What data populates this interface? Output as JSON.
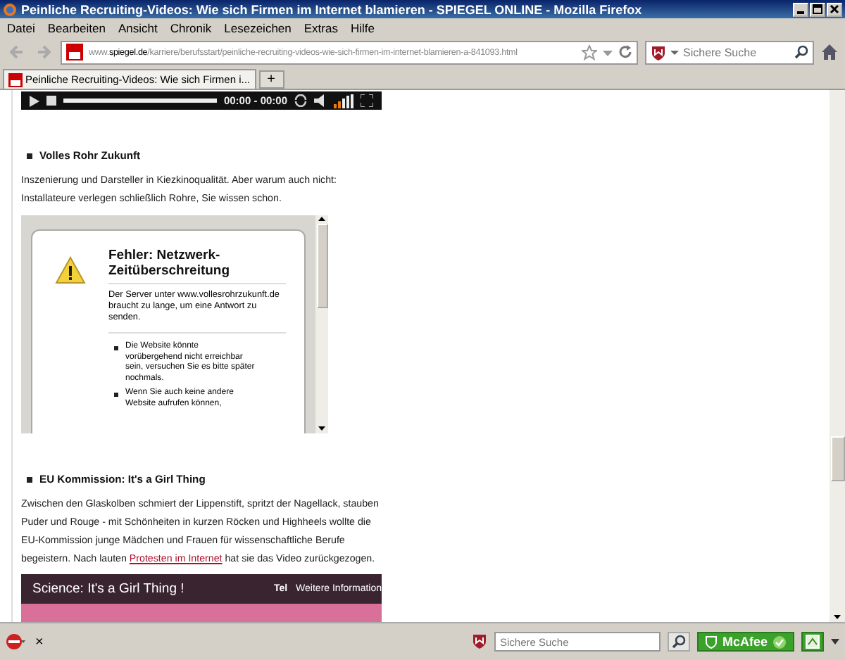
{
  "window": {
    "title": "Peinliche Recruiting-Videos: Wie sich Firmen im Internet blamieren - SPIEGEL ONLINE - Mozilla Firefox"
  },
  "menu": [
    "Datei",
    "Bearbeiten",
    "Ansicht",
    "Chronik",
    "Lesezeichen",
    "Extras",
    "Hilfe"
  ],
  "address_bar": {
    "url_prefix": "www.",
    "url_domain": "spiegel.de",
    "url_path": "/karriere/berufsstart/peinliche-recruiting-videos-wie-sich-firmen-im-internet-blamieren-a-841093.html"
  },
  "search_bar": {
    "placeholder": "Sichere Suche"
  },
  "tabs": [
    {
      "label": "Peinliche Recruiting-Videos: Wie sich Firmen i...",
      "selected": true
    }
  ],
  "new_tab": "+",
  "player": {
    "time": "00:00 - 00:00"
  },
  "sections": [
    {
      "heading": "Volles Rohr Zukunft",
      "text": "Inszenierung und Darsteller in Kiezkinoqualität. Aber warum auch nicht: Installateure verlegen schließlich Rohre, Sie wissen schon.",
      "kind": "error-frame",
      "error": {
        "title": "Fehler: Netzwerk-Zeitüberschreitung",
        "message": "Der Server unter www.vollesrohrzukunft.de braucht zu lange, um eine Antwort zu senden.",
        "tips": [
          "Die Website könnte vorübergehend nicht erreichbar sein, versuchen Sie es bitte später nochmals.",
          "Wenn Sie auch keine andere Website aufrufen können,"
        ]
      }
    },
    {
      "heading": "EU Kommission: It's a Girl Thing",
      "text_before": "Zwischen den Glaskolben schmiert der Lippenstift, spritzt der Nagellack, stauben Puder und Rouge - mit Schönheiten in kurzen Röcken und Highheels wollte die EU-Kommission junge Mädchen und Frauen für wissenschaftliche Berufe begeistern. Nach lauten",
      "link": "Protesten im Internet",
      "text_after": "hat sie das Video zurückgezogen.",
      "kind": "video",
      "video": {
        "title": "Science: It's a Girl Thing !",
        "logo": "Tel",
        "more": "Weitere Information"
      }
    }
  ],
  "addon_bar": {
    "close": "×",
    "search_placeholder": "Sichere Suche",
    "badge": "McAfee"
  }
}
